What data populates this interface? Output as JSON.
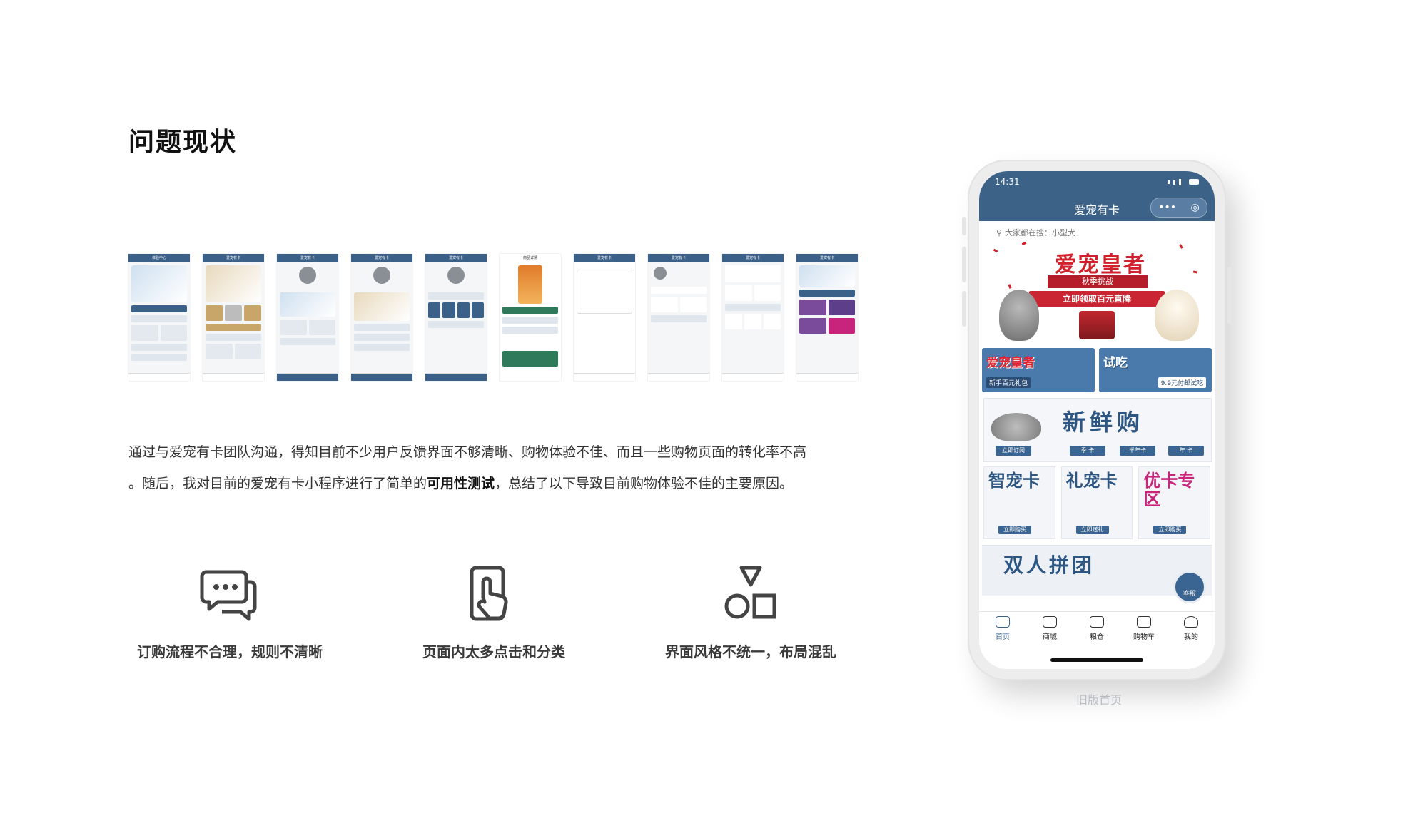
{
  "page": {
    "title": "问题现状",
    "description_line1": "通过与爱宠有卡团队沟通，得知目前不少用户反馈界面不够清晰、购物体验不佳、而且一些购物页面的转化率不高",
    "description_line2_prefix": "。随后，我对目前的爱宠有卡小程序进行了简单的",
    "description_line2_bold": "可用性测试",
    "description_line2_suffix": "，总结了以下导致目前购物体验不佳的主要原因。"
  },
  "thumbnails": [
    "体验中心",
    "爱宠有卡",
    "爱宠有卡",
    "爱宠有卡",
    "爱宠有卡",
    "商品详情",
    "爱宠有卡",
    "爱宠有卡",
    "爱宠有卡",
    "爱宠有卡"
  ],
  "issues": [
    {
      "icon": "chat-bubbles-icon",
      "label": "订购流程不合理，规则不清晰"
    },
    {
      "icon": "tap-hand-icon",
      "label": "页面内太多点击和分类"
    },
    {
      "icon": "shapes-icon",
      "label": "界面风格不统一，布局混乱"
    }
  ],
  "phone": {
    "time": "14:31",
    "app_title": "爱宠有卡",
    "capsule_more": "•••",
    "capsule_close": "◎",
    "search_placeholder": "大家都在搜：小型犬",
    "banner_title": "爱宠皇者",
    "banner_subtitle": "秋季挑战",
    "banner_cta": "立即领取百元直降",
    "promo_left_title": "爱宠皇者",
    "promo_left_tag": "新手百元礼包",
    "promo_right_title": "试吃",
    "promo_right_tag": "9.9元付邮试吃",
    "fresh_title": "新鲜购",
    "fresh_buttons": [
      "立即订阅",
      "季 卡",
      "半年卡",
      "年 卡"
    ],
    "cards": [
      {
        "title": "智宠卡",
        "button": "立即购买"
      },
      {
        "title": "礼宠卡",
        "button": "立即送礼"
      },
      {
        "title": "优卡专区",
        "button": "立即购买"
      }
    ],
    "group_title": "双人拼团",
    "service_label": "客服",
    "tabs": [
      "首页",
      "商城",
      "粮仓",
      "购物车",
      "我的"
    ]
  },
  "caption": "旧版首页",
  "colors": {
    "brand_blue": "#3d6288",
    "accent_red": "#d0202c",
    "pink": "#c8247b"
  }
}
